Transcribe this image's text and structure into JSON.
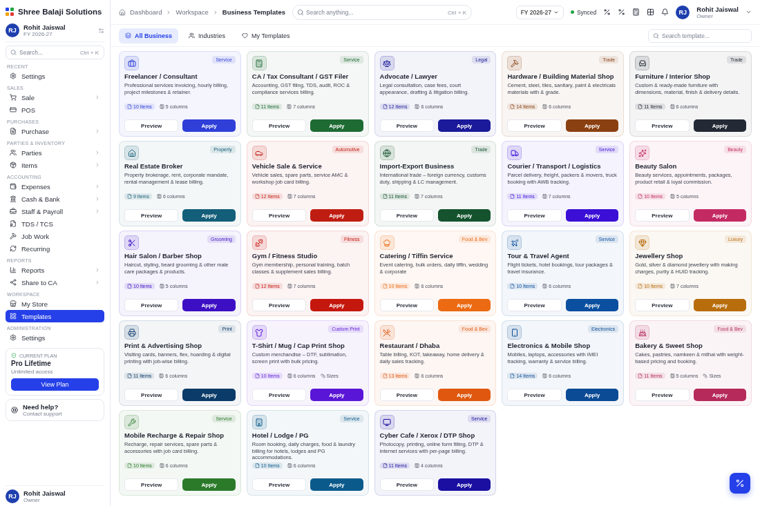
{
  "brand": {
    "name": "Shree Balaji Solutions"
  },
  "sidebar": {
    "user": {
      "initials": "RJ",
      "name": "Rohit Jaiswal",
      "subtitle": "FY 2026-27"
    },
    "search": {
      "placeholder": "Search...",
      "shortcut": "Ctrl + K"
    },
    "sections": [
      {
        "label": "RECENT",
        "items": [
          {
            "label": "Settings",
            "submenu": false,
            "selected": false
          }
        ]
      },
      {
        "label": "SALES",
        "items": [
          {
            "label": "Sale",
            "submenu": true,
            "selected": false
          },
          {
            "label": "POS",
            "submenu": false,
            "selected": false
          }
        ]
      },
      {
        "label": "PURCHASES",
        "items": [
          {
            "label": "Purchase",
            "submenu": true,
            "selected": false
          }
        ]
      },
      {
        "label": "PARTIES & INVENTORY",
        "items": [
          {
            "label": "Parties",
            "submenu": true,
            "selected": false
          },
          {
            "label": "Items",
            "submenu": true,
            "selected": false
          }
        ]
      },
      {
        "label": "ACCOUNTING",
        "items": [
          {
            "label": "Expenses",
            "submenu": true,
            "selected": false
          },
          {
            "label": "Cash & Bank",
            "submenu": true,
            "selected": false
          },
          {
            "label": "Staff & Payroll",
            "submenu": true,
            "selected": false
          },
          {
            "label": "TDS / TCS",
            "submenu": false,
            "selected": false
          },
          {
            "label": "Job Work",
            "submenu": false,
            "selected": false
          },
          {
            "label": "Recurring",
            "submenu": false,
            "selected": false
          }
        ]
      },
      {
        "label": "REPORTS",
        "items": [
          {
            "label": "Reports",
            "submenu": true,
            "selected": false
          },
          {
            "label": "Share to CA",
            "submenu": true,
            "selected": false
          }
        ]
      },
      {
        "label": "WORKSPACE",
        "items": [
          {
            "label": "My Store",
            "submenu": false,
            "selected": false
          },
          {
            "label": "Templates",
            "submenu": false,
            "selected": true
          }
        ]
      },
      {
        "label": "ADMINISTRATION",
        "items": [
          {
            "label": "Settings",
            "submenu": false,
            "selected": false
          }
        ]
      }
    ],
    "plan": {
      "label": "CURRENT PLAN",
      "name": "Pro Lifetime",
      "detail": "Unlimited access",
      "button": "View Plan"
    },
    "help": {
      "title": "Need help?",
      "subtitle": "Contact support"
    },
    "footer_user": {
      "initials": "RJ",
      "name": "Rohit Jaiswal",
      "role": "Owner"
    }
  },
  "topbar": {
    "breadcrumbs": [
      "Dashboard",
      "Workspace",
      "Business Templates"
    ],
    "search": {
      "placeholder": "Search anything...",
      "shortcut": "Ctrl + K"
    },
    "fiscal_year": "FY 2026-27",
    "sync_status": "Synced",
    "user": {
      "initials": "RJ",
      "name": "Rohit Jaiswal",
      "role": "Owner"
    }
  },
  "tabs": [
    {
      "label": "All Business",
      "selected": true
    },
    {
      "label": "Industries",
      "selected": false
    },
    {
      "label": "My Templates",
      "selected": false
    }
  ],
  "template_search": {
    "placeholder": "Search template..."
  },
  "templates": [
    {
      "title": "Freelancer / Consultant",
      "tag": "Service",
      "description": "Professional services invoicing, hourly billing, project milestones & retainer.",
      "items": "10 Items",
      "columns": "5 columns",
      "color": "#2f3fd8",
      "preview": "Preview",
      "apply": "Apply"
    },
    {
      "title": "CA / Tax Consultant / GST Filer",
      "tag": "Service",
      "description": "Accounting, GST filing, TDS, audit, ROC & compliance services billing.",
      "items": "11 Items",
      "columns": "7 columns",
      "color": "#1e6b34",
      "preview": "Preview",
      "apply": "Apply"
    },
    {
      "title": "Advocate / Lawyer",
      "tag": "Legal",
      "description": "Legal consultation, case fees, court appearance, drafting & litigation billing.",
      "items": "12 Items",
      "columns": "6 columns",
      "color": "#1a1a9a",
      "preview": "Preview",
      "apply": "Apply"
    },
    {
      "title": "Hardware / Building Material Shop",
      "tag": "Trade",
      "description": "Cement, steel, tiles, sanitary, paint & electricals materials with & grade.",
      "items": "14 Items",
      "columns": "6 columns",
      "color": "#8a4010",
      "preview": "Preview",
      "apply": "Apply"
    },
    {
      "title": "Furniture / Interior Shop",
      "tag": "Trade",
      "description": "Custom & ready-made furniture with dimensions, material, finish & delivery details.",
      "items": "11 Items",
      "columns": "6 columns",
      "color": "#232a35",
      "preview": "Preview",
      "apply": "Apply"
    },
    {
      "title": "Real Estate Broker",
      "tag": "Property",
      "description": "Property brokerage, rent, corporate mandate, rental management & lease billing.",
      "items": "9 Items",
      "columns": "6 columns",
      "color": "#135e78",
      "preview": "Preview",
      "apply": "Apply"
    },
    {
      "title": "Vehicle Sale & Service",
      "tag": "Automotive",
      "description": "Vehicle sales, spare parts, service AMC & workshop job card billing.",
      "items": "12 Items",
      "columns": "7 columns",
      "color": "#c01d12",
      "preview": "Preview",
      "apply": "Apply"
    },
    {
      "title": "Import-Export Business",
      "tag": "Trade",
      "description": "International trade – foreign currency, customs duty, shipping & LC management.",
      "items": "11 Items",
      "columns": "7 columns",
      "color": "#14532d",
      "preview": "Preview",
      "apply": "Apply"
    },
    {
      "title": "Courier / Transport / Logistics",
      "tag": "Service",
      "description": "Parcel delivery, freight, packers & movers, truck booking with AWB tracking.",
      "items": "11 Items",
      "columns": "7 columns",
      "color": "#3b0fd6",
      "preview": "Preview",
      "apply": "Apply"
    },
    {
      "title": "Beauty Salon",
      "tag": "Beauty",
      "description": "Beauty services, appointments, packages, product retail & loyal commission.",
      "items": "10 Items",
      "columns": "5 columns",
      "color": "#c42a62",
      "preview": "Preview",
      "apply": "Apply"
    },
    {
      "title": "Hair Salon / Barber Shop",
      "tag": "Grooming",
      "description": "Haircut, styling, beard grooming & other male care packages & products.",
      "items": "10 Items",
      "columns": "5 columns",
      "color": "#3d0fc4",
      "preview": "Preview",
      "apply": "Apply"
    },
    {
      "title": "Gym / Fitness Studio",
      "tag": "Fitness",
      "description": "Gym membership, personal training, batch classes & supplement sales billing.",
      "items": "12 Items",
      "columns": "7 columns",
      "color": "#c4180f",
      "preview": "Preview",
      "apply": "Apply"
    },
    {
      "title": "Catering / Tiffin Service",
      "tag": "Food & Bev",
      "description": "Event catering, bulk orders, daily tiffin, wedding & corporate",
      "items": "10 Items",
      "columns": "6 columns",
      "color": "#ec6a12",
      "preview": "Preview",
      "apply": "Apply"
    },
    {
      "title": "Tour & Travel Agent",
      "tag": "Service",
      "description": "Flight tickets, hotel bookings, tour packages & travel insurance.",
      "items": "10 Items",
      "columns": "6 columns",
      "color": "#0b4fa0",
      "preview": "Preview",
      "apply": "Apply"
    },
    {
      "title": "Jewellery Shop",
      "tag": "Luxury",
      "description": "Gold, silver & diamond jewellery with making charges, purity & HUID tracking.",
      "items": "10 Items",
      "columns": "7 columns",
      "color": "#b86d0c",
      "preview": "Preview",
      "apply": "Apply"
    },
    {
      "title": "Print & Advertising Shop",
      "tag": "Print",
      "description": "Visiting cards, banners, flex, hoarding & digital printing with job-wise billing.",
      "items": "11 Items",
      "columns": "6 columns",
      "color": "#0b3b68",
      "preview": "Preview",
      "apply": "Apply"
    },
    {
      "title": "T-Shirt / Mug / Cap Print Shop",
      "tag": "Custom Print",
      "description": "Custom merchandise – DTF, sublimation, screen print with bulk pricing.",
      "items": "10 Items",
      "columns": "6 columns",
      "sizes": "Sizes",
      "color": "#5a16d6",
      "preview": "Preview",
      "apply": "Apply"
    },
    {
      "title": "Restaurant / Dhaba",
      "tag": "Food & Bev",
      "description": "Table billing, KOT, takeaway, home delivery & daily sales tracking.",
      "items": "13 Items",
      "columns": "6 columns",
      "color": "#e0580f",
      "preview": "Preview",
      "apply": "Apply"
    },
    {
      "title": "Electronics & Mobile Shop",
      "tag": "Electronics",
      "description": "Mobiles, laptops, accessories with IMEI tracking, warranty & service billing.",
      "items": "14 Items",
      "columns": "6 columns",
      "color": "#0b4a94",
      "preview": "Preview",
      "apply": "Apply"
    },
    {
      "title": "Bakery & Sweet Shop",
      "tag": "Food & Bev",
      "description": "Cakes, pastries, namkeen & mithai with weight-based pricing and booking.",
      "items": "11 Items",
      "columns": "5 columns",
      "sizes": "Sizes",
      "color": "#b52a5a",
      "preview": "Preview",
      "apply": "Apply"
    },
    {
      "title": "Mobile Recharge & Repair Shop",
      "tag": "Service",
      "description": "Recharge, repair services, spare parts & accessories with job card billing.",
      "items": "10 Items",
      "columns": "6 columns",
      "color": "#2a7a2a",
      "preview": "Preview",
      "apply": "Apply"
    },
    {
      "title": "Hotel / Lodge / PG",
      "tag": "Service",
      "description": "Room booking, daily charges, food & laundry billing for hotels, lodges and PG accommodations.",
      "items": "10 Items",
      "columns": "6 columns",
      "color": "#0b5a8c",
      "preview": "Preview",
      "apply": "Apply"
    },
    {
      "title": "Cyber Cafe / Xerox / DTP Shop",
      "tag": "Service",
      "description": "Photocopy, printing, online form filling, DTP & internet services with per-page billing.",
      "items": "11 Items",
      "columns": "4 columns",
      "color": "#1a0fa0",
      "preview": "Preview",
      "apply": "Apply"
    }
  ]
}
